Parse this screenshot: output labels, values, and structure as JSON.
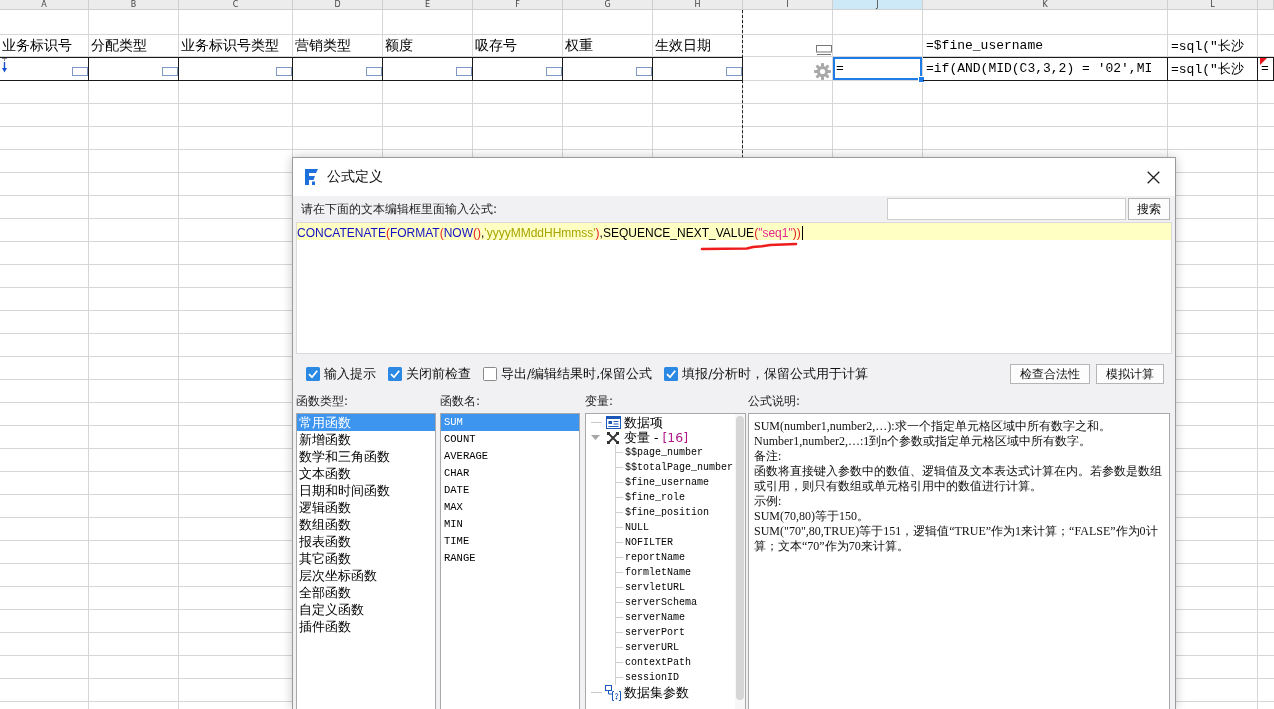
{
  "sheet": {
    "columns": [
      {
        "label": "A",
        "selected": false
      },
      {
        "label": "B",
        "selected": false
      },
      {
        "label": "C",
        "selected": false
      },
      {
        "label": "D",
        "selected": false
      },
      {
        "label": "E",
        "selected": false
      },
      {
        "label": "F",
        "selected": false
      },
      {
        "label": "G",
        "selected": false
      },
      {
        "label": "H",
        "selected": false
      },
      {
        "label": "I",
        "selected": false
      },
      {
        "label": "J",
        "selected": true
      },
      {
        "label": "K",
        "selected": false
      },
      {
        "label": "L",
        "selected": false
      },
      {
        "selected": false
      }
    ],
    "rows": [
      {
        "cells": [
          {
            "kind": "text",
            "text": "业务标识号",
            "bordered": false,
            "selected": false
          },
          {
            "kind": "text",
            "text": "分配类型",
            "bordered": false,
            "selected": false
          },
          {
            "kind": "text",
            "text": "业务标识号类型",
            "bordered": false,
            "selected": false
          },
          {
            "kind": "text",
            "text": "营销类型",
            "bordered": false,
            "selected": false
          },
          {
            "kind": "text",
            "text": "额度",
            "bordered": false,
            "selected": false
          },
          {
            "kind": "text",
            "text": "吸存号",
            "bordered": false,
            "selected": false
          },
          {
            "kind": "text",
            "text": "权重",
            "bordered": false,
            "selected": false
          },
          {
            "kind": "text",
            "text": "生效日期",
            "bordered": false,
            "selected": false
          },
          {
            "kind": "screen",
            "bordered": false,
            "selected": false
          },
          {
            "kind": "empty"
          },
          {
            "kind": "formula",
            "text": "=$fine_username",
            "bordered": false,
            "selected": false
          },
          {
            "kind": "formula",
            "text": "=sql(\"长沙",
            "bordered": false,
            "selected": false
          },
          {
            "kind": "empty"
          }
        ]
      },
      {
        "cells": [
          {
            "kind": "expand-widget",
            "bordered": true,
            "selected": false
          },
          {
            "kind": "widget",
            "bordered": true,
            "selected": false
          },
          {
            "kind": "widget",
            "bordered": true,
            "selected": false
          },
          {
            "kind": "widget",
            "bordered": true,
            "selected": false
          },
          {
            "kind": "widget",
            "bordered": true,
            "selected": false
          },
          {
            "kind": "widget",
            "bordered": true,
            "selected": false
          },
          {
            "kind": "widget",
            "bordered": true,
            "selected": false
          },
          {
            "kind": "widget",
            "bordered": true,
            "selected": false
          },
          {
            "kind": "gear",
            "bordered": false,
            "selected": false
          },
          {
            "kind": "formula",
            "text": "=",
            "bordered": false,
            "selected": true
          },
          {
            "kind": "formula",
            "text": "=if(AND(MID(C3,3,2) = '02',MI",
            "bordered": true,
            "selected": false
          },
          {
            "kind": "formula",
            "text": "=sql(\"长沙",
            "bordered": true,
            "selected": false
          },
          {
            "kind": "comment",
            "text": "=",
            "bordered": true,
            "selected": false
          }
        ]
      }
    ]
  },
  "dialog": {
    "title": "公式定义",
    "prompt": "请在下面的文本编辑框里面输入公式:",
    "search": {
      "button": "搜索"
    },
    "formula": {
      "tokens": [
        {
          "kind": "function",
          "text": "CONCATENATE"
        },
        {
          "kind": "paren",
          "text": "("
        },
        {
          "kind": "function",
          "text": "FORMAT"
        },
        {
          "kind": "paren",
          "text": "("
        },
        {
          "kind": "function",
          "text": "NOW"
        },
        {
          "kind": "paren",
          "text": "()"
        },
        {
          "kind": "plain",
          "text": ","
        },
        {
          "kind": "string",
          "text": "'yyyyMMddHHmmss'"
        },
        {
          "kind": "paren",
          "text": ")"
        },
        {
          "kind": "plain",
          "text": ","
        },
        {
          "kind": "plain",
          "text": "SEQUENCE_NEXT_VALUE"
        },
        {
          "kind": "paren",
          "text": "("
        },
        {
          "kind": "quoted",
          "text": "\"seq1\""
        },
        {
          "kind": "paren",
          "text": "))"
        }
      ],
      "underline_mark": true
    },
    "options": [
      {
        "label": "输入提示",
        "checked": true
      },
      {
        "label": "关闭前检查",
        "checked": true
      },
      {
        "label": "导出/编辑结果时,保留公式",
        "checked": false
      },
      {
        "label": "填报/分析时，保留公式用于计算",
        "checked": true
      }
    ],
    "buttons": [
      "检查合法性",
      "模拟计算"
    ],
    "function_types": {
      "label": "函数类型:",
      "items": [
        {
          "label": "常用函数",
          "selected": true
        },
        {
          "label": "新增函数",
          "selected": false
        },
        {
          "label": "数学和三角函数",
          "selected": false
        },
        {
          "label": "文本函数",
          "selected": false
        },
        {
          "label": "日期和时间函数",
          "selected": false
        },
        {
          "label": "逻辑函数",
          "selected": false
        },
        {
          "label": "数组函数",
          "selected": false
        },
        {
          "label": "报表函数",
          "selected": false
        },
        {
          "label": "其它函数",
          "selected": false
        },
        {
          "label": "层次坐标函数",
          "selected": false
        },
        {
          "label": "全部函数",
          "selected": false
        },
        {
          "label": "自定义函数",
          "selected": false
        },
        {
          "label": "插件函数",
          "selected": false
        }
      ]
    },
    "function_names": {
      "label": "函数名:",
      "items": [
        {
          "label": "SUM",
          "selected": true
        },
        {
          "label": "COUNT",
          "selected": false
        },
        {
          "label": "AVERAGE",
          "selected": false
        },
        {
          "label": "CHAR",
          "selected": false
        },
        {
          "label": "DATE",
          "selected": false
        },
        {
          "label": "MAX",
          "selected": false
        },
        {
          "label": "MIN",
          "selected": false
        },
        {
          "label": "TIME",
          "selected": false
        },
        {
          "label": "RANGE",
          "selected": false
        }
      ]
    },
    "variables": {
      "label": "变量:",
      "nodes": [
        {
          "kind": "data",
          "label": "数据项",
          "selected": false
        },
        {
          "kind": "variables",
          "label": "变量",
          "separator": "-",
          "count": "[16]",
          "expanded": true,
          "selected": false,
          "children": [
            {
              "label": "$$page_number",
              "selected": false
            },
            {
              "label": "$$totalPage_number",
              "selected": false
            },
            {
              "label": "$fine_username",
              "selected": false
            },
            {
              "label": "$fine_role",
              "selected": false
            },
            {
              "label": "$fine_position",
              "selected": false
            },
            {
              "label": "NULL",
              "selected": false
            },
            {
              "label": "NOFILTER",
              "selected": false
            },
            {
              "label": "reportName",
              "selected": false
            },
            {
              "label": "formletName",
              "selected": false
            },
            {
              "label": "servletURL",
              "selected": false
            },
            {
              "label": "serverSchema",
              "selected": false
            },
            {
              "label": "serverName",
              "selected": false
            },
            {
              "label": "serverPort",
              "selected": false
            },
            {
              "label": "serverURL",
              "selected": false
            },
            {
              "label": "contextPath",
              "selected": false
            },
            {
              "label": "sessionID",
              "selected": false
            }
          ]
        },
        {
          "kind": "dataset",
          "label": "数据集参数",
          "selected": false
        }
      ]
    },
    "description": {
      "label": "公式说明:",
      "paragraphs": [
        "SUM(number1,number2,…):求一个指定单元格区域中所有数字之和。",
        "Number1,number2,…:1到n个参数或指定单元格区域中所有数字。",
        "备注:",
        "函数将直接键入参数中的数值、逻辑值及文本表达式计算在内。若参数是数组或引用，则只有数组或单元格引用中的数值进行计算。",
        "示例:",
        "SUM(70,80)等于150。",
        "SUM(\"70\",80,TRUE)等于151，逻辑值“TRUE”作为1来计算；“FALSE”作为0计算；文本“70”作为70来计算。"
      ]
    }
  }
}
